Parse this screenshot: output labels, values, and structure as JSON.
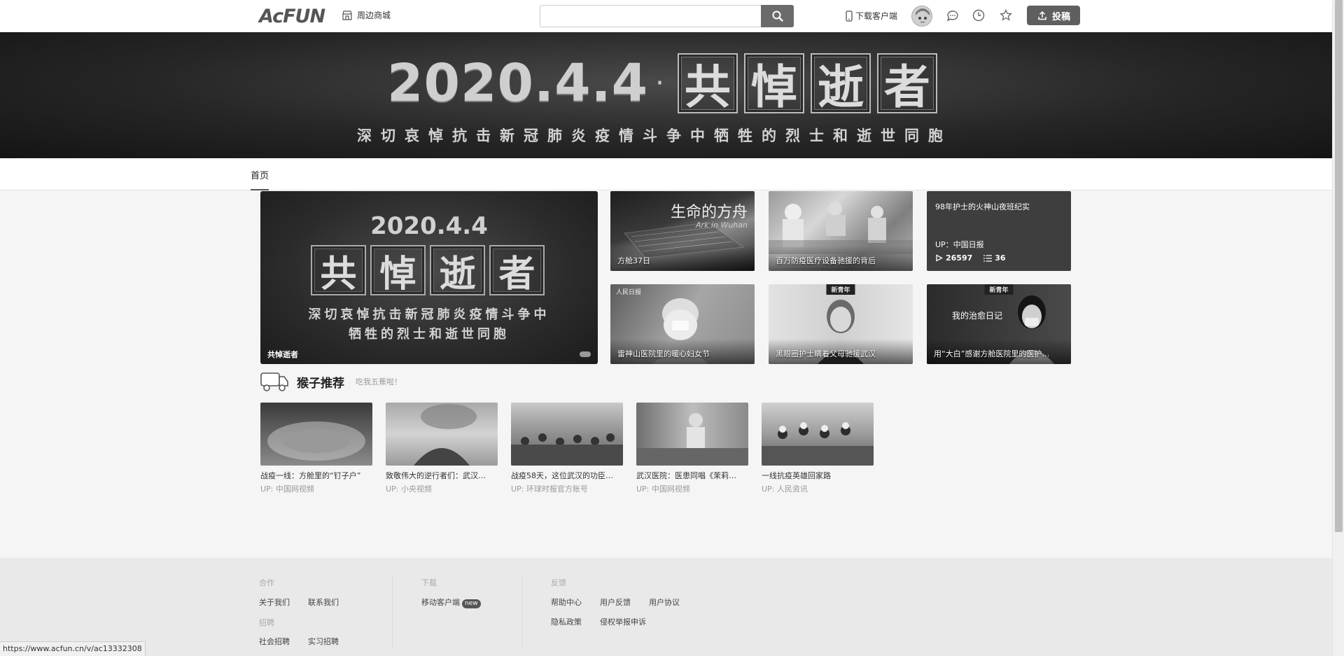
{
  "header": {
    "logo": "AcFUN",
    "shop_label": "周边商城",
    "search_placeholder": "",
    "download_label": "下载客户端",
    "upload_label": "投稿"
  },
  "banner": {
    "date": "2020.4.4",
    "chars": [
      "共",
      "悼",
      "逝",
      "者"
    ],
    "subtitle": "深切哀悼抗击新冠肺炎疫情斗争中牺牲的烈士和逝世同胞"
  },
  "nav": {
    "home": "首页"
  },
  "hero": {
    "date": "2020.4.4",
    "chars": [
      "共",
      "悼",
      "逝",
      "者"
    ],
    "sub1": "深切哀悼抗击新冠肺炎疫情斗争中",
    "sub2": "牺牲的烈士和逝世同胞",
    "caption": "共悼逝者"
  },
  "tiles": [
    {
      "caption": "方舱37日",
      "overlay_title": "生命的方舟",
      "overlay_sub": "Ark in Wuhan"
    },
    {
      "caption": "百万防疫医疗设备驰援的背后"
    },
    {
      "title": "98年护士的火神山夜班纪实",
      "up": "UP：中国日报",
      "plays": "26597",
      "danmaku": "36"
    },
    {
      "caption": "雷神山医院里的暖心妇女节",
      "tag": "人民日报"
    },
    {
      "caption": "黑眼圈护士瞒着父母驰援武汉",
      "tag": "新青年"
    },
    {
      "caption": "用“大白”感谢方舱医院里的医护…",
      "tag": "新青年",
      "overlay_title": "我的治愈日记"
    }
  ],
  "recommend": {
    "title": "猴子推荐",
    "subtitle": "吃我五蕉啦！",
    "items": [
      {
        "title": "战疫一线：方舱里的“钉子户”",
        "up": "UP:  中国网视频"
      },
      {
        "title": "致敬伟大的逆行者们：武汉…",
        "up": "UP:  小央视频"
      },
      {
        "title": "战疫58天，这位武汉的功臣…",
        "up": "UP:  环球时报官方账号"
      },
      {
        "title": "武汉医院：医患同唱《茉莉…",
        "up": "UP:  中国网视频"
      },
      {
        "title": "一线抗疫英雄回家路",
        "up": "UP:  人民资讯"
      }
    ]
  },
  "footer": {
    "coop_title": "合作",
    "coop_links": [
      "关于我们",
      "联系我们"
    ],
    "recruit_title": "招聘",
    "recruit_links": [
      "社会招聘",
      "实习招聘"
    ],
    "download_title": "下载",
    "download_link": "移动客户端",
    "new_badge": "new",
    "feedback_title": "反馈",
    "feedback_links": [
      "帮助中心",
      "用户反馈",
      "用户协议",
      "隐私政策",
      "侵权举报申诉"
    ]
  },
  "status_url": "https://www.acfun.cn/v/ac13332308"
}
